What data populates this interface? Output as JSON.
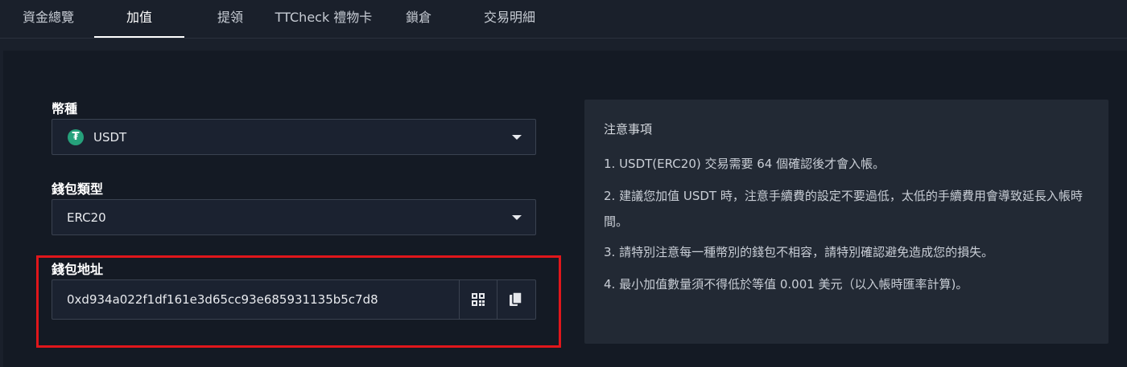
{
  "tabs": [
    {
      "label": "資金總覽"
    },
    {
      "label": "加值"
    },
    {
      "label": "提領"
    },
    {
      "label": "TTCheck 禮物卡"
    },
    {
      "label": "鎖倉"
    },
    {
      "label": "交易明細"
    }
  ],
  "active_tab": "加值",
  "form": {
    "currency_label": "幣種",
    "currency_value": "USDT",
    "currency_icon_glyph": "₮",
    "wallet_type_label": "錢包類型",
    "wallet_type_value": "ERC20",
    "address_label": "錢包地址",
    "address_value": "0xd934a022f1df161e3d65cc93e685931135b5c7d8"
  },
  "notes": {
    "title": "注意事項",
    "items": [
      "1. USDT(ERC20) 交易需要 64 個確認後才會入帳。",
      "2. 建議您加值 USDT 時，注意手續費的設定不要過低，太低的手續費用會導致延長入帳時間。",
      "3. 請特別注意每一種幣別的錢包不相容，請特別確認避免造成您的損失。",
      "4. 最小加值數量須不得低於等值 0.001 美元（以入帳時匯率計算)。"
    ]
  },
  "colors": {
    "highlight": "#e0161b",
    "usdt_green": "#26a17b"
  },
  "icons": {
    "currency": "usdt-icon",
    "dropdown": "caret-down-icon",
    "qr": "qr-code-icon",
    "copy": "copy-icon"
  }
}
